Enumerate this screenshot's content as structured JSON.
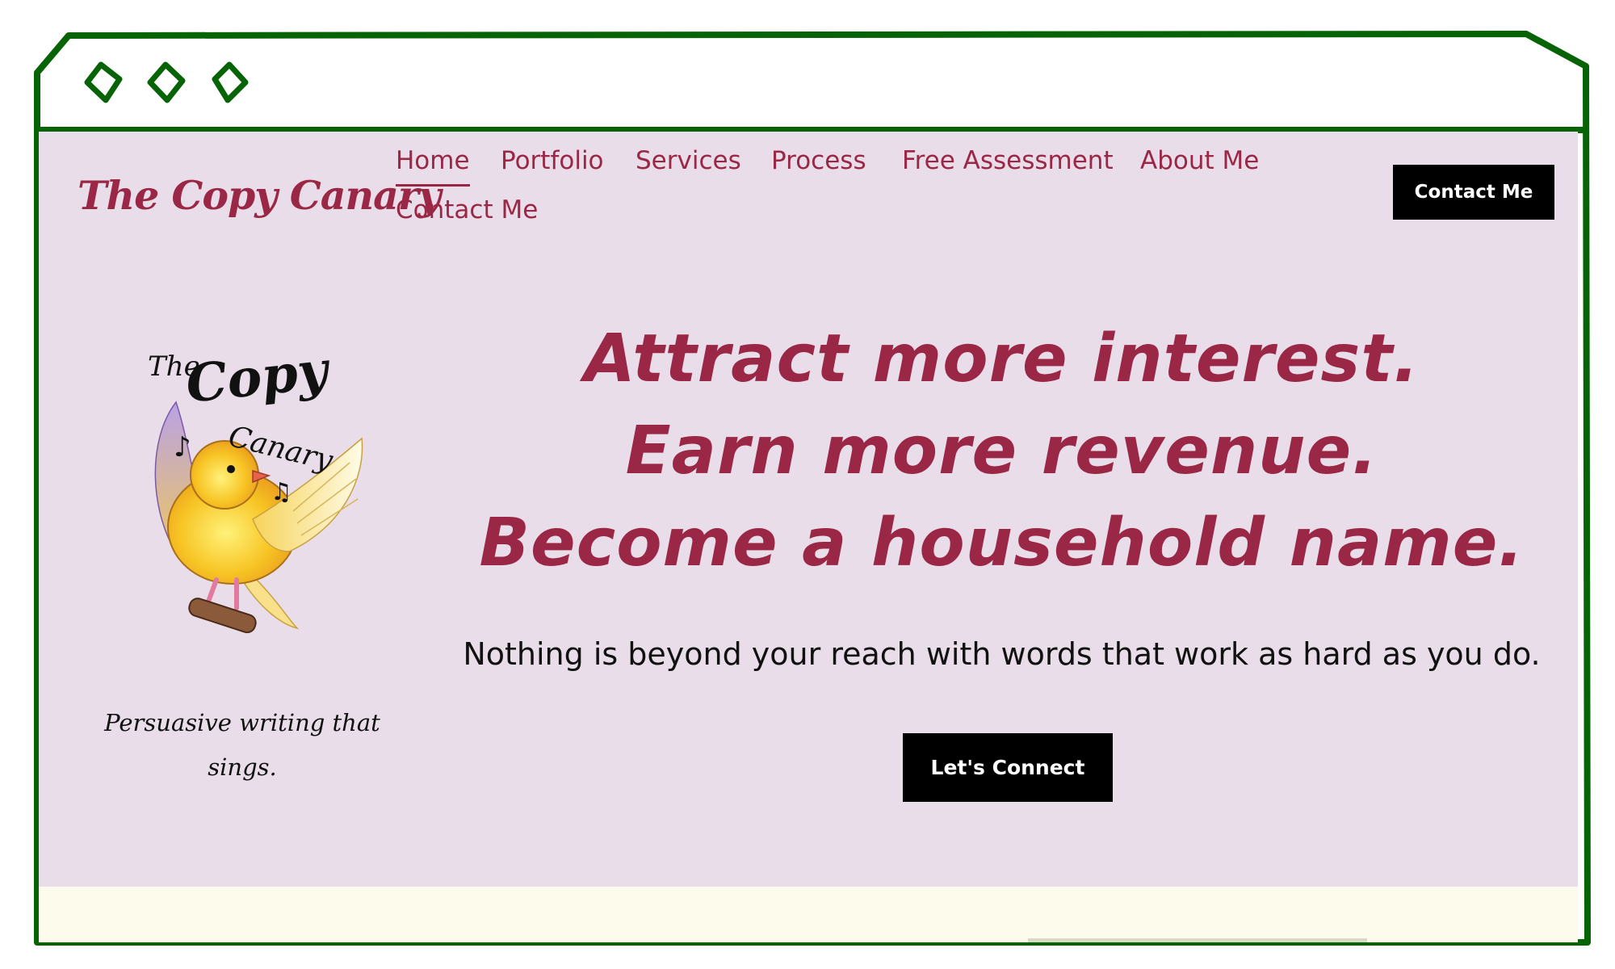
{
  "colors": {
    "frame": "#076406",
    "page_bg": "#e8dde8",
    "brand": "#9a2745",
    "button_bg": "#000000",
    "button_text": "#ffffff",
    "footer_bg": "#fdfcec"
  },
  "browser": {
    "window_controls": [
      "window-control-icon",
      "window-control-icon",
      "window-control-icon"
    ]
  },
  "header": {
    "logo_text": "The Copy Canary",
    "nav": [
      {
        "label": "Home",
        "active": true
      },
      {
        "label": "Portfolio"
      },
      {
        "label": "Services"
      },
      {
        "label": "Process"
      },
      {
        "label": "Free Assessment"
      },
      {
        "label": "About Me"
      },
      {
        "label": "Contact Me"
      }
    ],
    "cta_label": "Contact Me"
  },
  "sidebar": {
    "logo_art_text": [
      "The",
      "Copy",
      "Canary"
    ],
    "tagline": "Persuasive writing that sings."
  },
  "hero": {
    "headline": [
      "Attract more interest.",
      "Earn more revenue.",
      "Become a household name."
    ],
    "subheadline": "Nothing is beyond your reach with words that work as hard as you do.",
    "cta_label": "Let's Connect"
  }
}
